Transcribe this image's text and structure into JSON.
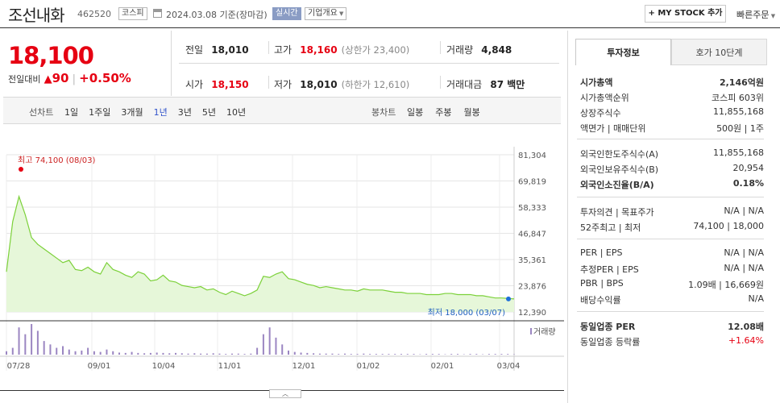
{
  "header": {
    "stock_name": "조선내화",
    "stock_code": "462520",
    "market": "코스피",
    "date_text": "2024.03.08 기준(장마감)",
    "realtime": "실시간",
    "company_info": "기업개요",
    "mystock_btn": "+ MY STOCK 추가",
    "quick_order": "빠른주문"
  },
  "quote": {
    "price": "18,100",
    "change_label": "전일대비",
    "change_value": "90",
    "change_pct": "+0.50%",
    "prev_close_lbl": "전일",
    "prev_close": "18,010",
    "high_lbl": "고가",
    "high": "18,160",
    "upper_limit": "(상한가 23,400)",
    "volume_lbl": "거래량",
    "volume": "4,848",
    "open_lbl": "시가",
    "open": "18,150",
    "low_lbl": "저가",
    "low": "18,010",
    "lower_limit": "(하한가 12,610)",
    "amount_lbl": "거래대금",
    "amount": "87 백만"
  },
  "periods": {
    "line_label": "선차트",
    "line_items": [
      "1일",
      "1주일",
      "3개월",
      "1년",
      "3년",
      "5년",
      "10년"
    ],
    "active": "1년",
    "candle_label": "봉차트",
    "candle_items": [
      "일봉",
      "주봉",
      "월봉"
    ]
  },
  "chart_data": {
    "type": "area",
    "y_ticks": [
      "81,304",
      "69,819",
      "58,333",
      "46,847",
      "35,361",
      "23,876",
      "12,390"
    ],
    "ylim": [
      12390,
      81304
    ],
    "x_ticks": [
      "07/28",
      "09/01",
      "10/04",
      "11/01",
      "12/01",
      "01/02",
      "02/01",
      "03/04"
    ],
    "high_annotation": "최고 74,100 (08/03)",
    "low_annotation": "최저 18,000 (03/07)",
    "volume_label": "거래량",
    "line_color": "#7cd13a",
    "fill_color": "#e6f7d9",
    "price_series": [
      30000,
      52000,
      63000,
      55000,
      45000,
      42000,
      40000,
      38000,
      36000,
      34000,
      35000,
      31000,
      30500,
      32000,
      30000,
      29000,
      34000,
      31000,
      30000,
      28500,
      27500,
      30000,
      29000,
      26000,
      26500,
      28500,
      26000,
      25500,
      24000,
      23500,
      23000,
      23500,
      22000,
      22500,
      21000,
      20000,
      21500,
      20500,
      19500,
      20500,
      22000,
      28000,
      27500,
      29000,
      30000,
      27000,
      26500,
      25500,
      24500,
      24000,
      23000,
      23500,
      23000,
      22500,
      22000,
      22000,
      21500,
      22500,
      22000,
      22000,
      22000,
      21500,
      21000,
      21000,
      20500,
      20500,
      20500,
      20000,
      20000,
      20000,
      20500,
      20500,
      20000,
      20000,
      20000,
      19500,
      19500,
      19000,
      18500,
      18500,
      18300,
      18100
    ],
    "volume_series": [
      10,
      20,
      80,
      60,
      90,
      70,
      40,
      30,
      20,
      25,
      15,
      10,
      12,
      20,
      10,
      8,
      15,
      10,
      6,
      5,
      8,
      5,
      4,
      5,
      6,
      5,
      4,
      5,
      4,
      3,
      4,
      3,
      3,
      4,
      3,
      2,
      3,
      3,
      2,
      3,
      20,
      60,
      80,
      50,
      30,
      12,
      8,
      6,
      5,
      4,
      3,
      3,
      3,
      2,
      3,
      2,
      2,
      3,
      2,
      2,
      2,
      2,
      2,
      2,
      2,
      2,
      1,
      2,
      2,
      2,
      1,
      2,
      2,
      1,
      2,
      2,
      1,
      2,
      2,
      2,
      2,
      1
    ],
    "volume_color": "#9b86c2"
  },
  "tabs": {
    "invest": "투자정보",
    "hoga": "호가 10단계"
  },
  "invest": {
    "g1": [
      {
        "l": "시가총액",
        "r": "2,146억원",
        "bold": true
      },
      {
        "l": "시가총액순위",
        "r": "코스피 603위"
      },
      {
        "l": "상장주식수",
        "r": "11,855,168"
      },
      {
        "l": "액면가 | 매매단위",
        "r": "500원 | 1주"
      }
    ],
    "g2": [
      {
        "l": "외국인한도주식수(A)",
        "r": "11,855,168"
      },
      {
        "l": "외국인보유주식수(B)",
        "r": "20,954"
      },
      {
        "l": "외국인소진율(B/A)",
        "r": "0.18%",
        "bold": true
      }
    ],
    "g3": [
      {
        "l": "투자의견 | 목표주가",
        "r": "N/A | N/A"
      },
      {
        "l": "52주최고 | 최저",
        "r": "74,100 | 18,000"
      }
    ],
    "g4": [
      {
        "l": "PER | EPS",
        "r": "N/A | N/A"
      },
      {
        "l": "추정PER | EPS",
        "r": "N/A | N/A"
      },
      {
        "l": "PBR | BPS",
        "r": "1.09배 | 16,669원"
      },
      {
        "l": "배당수익률",
        "r": "N/A"
      }
    ],
    "g5": [
      {
        "l": "동일업종 PER",
        "r": "12.08배",
        "bold": true
      },
      {
        "l": "동일업종 등락률",
        "r": "+1.64%",
        "red": true
      }
    ]
  },
  "collapse_icon": "chevron-up-icon"
}
